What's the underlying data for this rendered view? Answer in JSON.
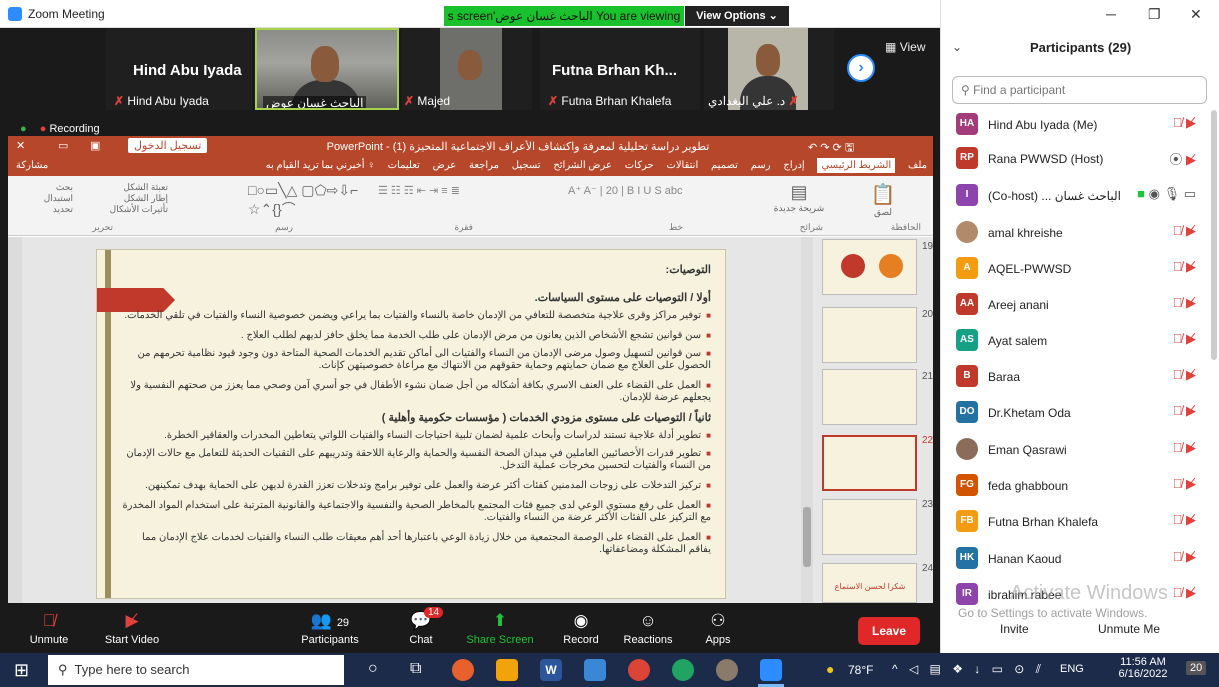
{
  "window": {
    "title": "Zoom Meeting"
  },
  "share_banner": {
    "viewing": "You are viewing الباحث غسان عوض's screen",
    "view_options": "View Options ⌄"
  },
  "gallery": {
    "tile1_name": "Hind Abu Iyada",
    "tile1_label": "Hind Abu Iyada",
    "tile2_label": "الباحث غسان عوض",
    "tile3_label": "Majed",
    "tile4_name": "Futna Brhan Kh...",
    "tile4_label": "Futna Brhan Khalefa",
    "tile5_label": "د. علي البغدادي",
    "view_label": "View",
    "recording": "Recording"
  },
  "powerpoint": {
    "title": "تطوير دراسة تحليلية لمعرفة واكتشاف الأعراف الاجتماعية المتحيزة (1) - PowerPoint",
    "signin": "تسجيل الدخول",
    "share": "مشاركة",
    "tabs": [
      "ملف",
      "الشريط الرئيسي",
      "إدراج",
      "رسم",
      "تصميم",
      "انتقالات",
      "حركات",
      "عرض الشرائح",
      "تسجيل",
      "مراجعة",
      "عرض",
      "تعليمات",
      "أخبرني بما تريد القيام به"
    ],
    "groups": [
      "الحافظة",
      "شرائح",
      "خط",
      "فقرة",
      "رسم",
      "تحرير"
    ],
    "ribbon_labels": [
      "لصق",
      "شريحة جديدة",
      "تخطيط",
      "إعادة تعيين",
      "مقطع",
      "بحث",
      "استبدال",
      "تحديد",
      "أشكال",
      "ترتيب",
      "أنماط سريعة",
      "تعبئة الشكل",
      "إطار الشكل",
      "تأثيرات الأشكال"
    ],
    "slide": {
      "heading": "التوصيات:",
      "section1": "أولا / التوصيات على مستوى السياسات.",
      "bullets1": [
        "توفير مراكز وقرى علاجية متخصصة للتعافي من الإدمان خاصة بالنساء والفتيات بما يراعي ويضمن خصوصية النساء والفتيات في تلقي الخدمات.",
        "سن قوانين تشجع الأشخاص الذين يعانون من مرض الإدمان على طلب الخدمة مما يخلق حافز لديهم لطلب العلاج .",
        "سن قوانين لتسهيل وصول مرضى الإدمان من النساء والفتيات الى أماكن تقديم الخدمات الصحية المتاحة دون وجود قيود نظامية تحرمهم من الحصول على العلاج مع ضمان حمايتهم وحماية حقوقهم من الانتهاك مع مراعاة خصوصيتهن كإناث.",
        "العمل على القضاء على العنف الاسري بكافة أشكاله من أجل ضمان نشوء الأطفال في جو أسري آمن وصحي مما يعزز من صحتهم النفسية ولا يجعلهم عرضة للإدمان."
      ],
      "section2": "ثانياً / التوصيات على مستوى مزودي الخدمات ( مؤسسات حكومية وأهلية )",
      "bullets2": [
        "تطوير أدلة علاجية تستند لدراسات وأبحاث علمية لضمان تلبية احتياجات النساء والفتيات اللواتي يتعاطين المخدرات والعقاقير الخطرة.",
        "تطوير قدرات الأخصائيين العاملين في ميدان الصحة النفسية والحماية والرعاية اللاحقة وتدريبهم على التقنيات الحديثة للتعامل مع حالات الإدمان من النساء والفتيات لتحسين مخرجات عملية التدخل.",
        "تركيز التدخلات على زوجات المدمنين كفئات أكثر عرضة والعمل على توفير برامج وتدخلات تعزز القدرة لديهن على الحماية بهدف تمكينهن.",
        "العمل على رفع مستوى الوعي لدى جميع فئات المجتمع بالمخاطر الصحية والنفسية والاجتماعية والقانونية المترتبة على استخدام المواد المخدرة مع التركيز على الفئات الأكثر عرضة من النساء والفتيات.",
        "العمل على القضاء على الوصمة المجتمعية من خلال زيادة الوعي باعتبارها أحد أهم معيقات طلب النساء والفتيات لخدمات علاج الإدمان مما يفاقم المشكلة ومضاعفاتها."
      ]
    },
    "thumb_numbers": [
      "19",
      "20",
      "21",
      "22",
      "23",
      "24"
    ],
    "thumb24_title": "شكرا لحسن الاستماع"
  },
  "toolbar": {
    "unmute": "Unmute",
    "start_video": "Start Video",
    "participants": "Participants",
    "participants_count": "29",
    "chat": "Chat",
    "chat_badge": "14",
    "share_screen": "Share Screen",
    "record": "Record",
    "reactions": "Reactions",
    "apps": "Apps",
    "leave": "Leave"
  },
  "panel": {
    "title": "Participants (29)",
    "search_placeholder": "Find a participant",
    "participants": [
      {
        "initials": "HA",
        "name": "Hind Abu Iyada (Me)",
        "color": "#a43b7b"
      },
      {
        "initials": "RP",
        "name": "Rana PWWSD (Host)",
        "color": "#c0392b"
      },
      {
        "initials": "I",
        "name": "الباحث غسان ... (Co-host)",
        "color": "#8e44ad"
      },
      {
        "initials": "",
        "name": "amal khreishe",
        "color": "#b08a6a"
      },
      {
        "initials": "A",
        "name": "AQEL-PWWSD",
        "color": "#f39c12"
      },
      {
        "initials": "AA",
        "name": "Areej anani",
        "color": "#c0392b"
      },
      {
        "initials": "AS",
        "name": "Ayat salem",
        "color": "#16a085"
      },
      {
        "initials": "B",
        "name": "Baraa",
        "color": "#c0392b"
      },
      {
        "initials": "DO",
        "name": "Dr.Khetam Oda",
        "color": "#2471a3"
      },
      {
        "initials": "",
        "name": "Eman Qasrawi",
        "color": "#8b6b5a"
      },
      {
        "initials": "FG",
        "name": "feda ghabboun",
        "color": "#d35400"
      },
      {
        "initials": "FB",
        "name": "Futna Brhan Khalefa",
        "color": "#f39c12"
      },
      {
        "initials": "HK",
        "name": "Hanan Kaoud",
        "color": "#2471a3"
      },
      {
        "initials": "IR",
        "name": "ibrahim rabee",
        "color": "#8e44ad"
      }
    ],
    "activate1": "Activate Windows",
    "activate2": "Go to Settings to activate Windows.",
    "invite": "Invite",
    "unmute_me": "Unmute Me"
  },
  "taskbar": {
    "search": "Type here to search",
    "weather": "78°F",
    "lang": "ENG",
    "time": "11:56 AM",
    "date": "6/16/2022",
    "notif": "20"
  }
}
